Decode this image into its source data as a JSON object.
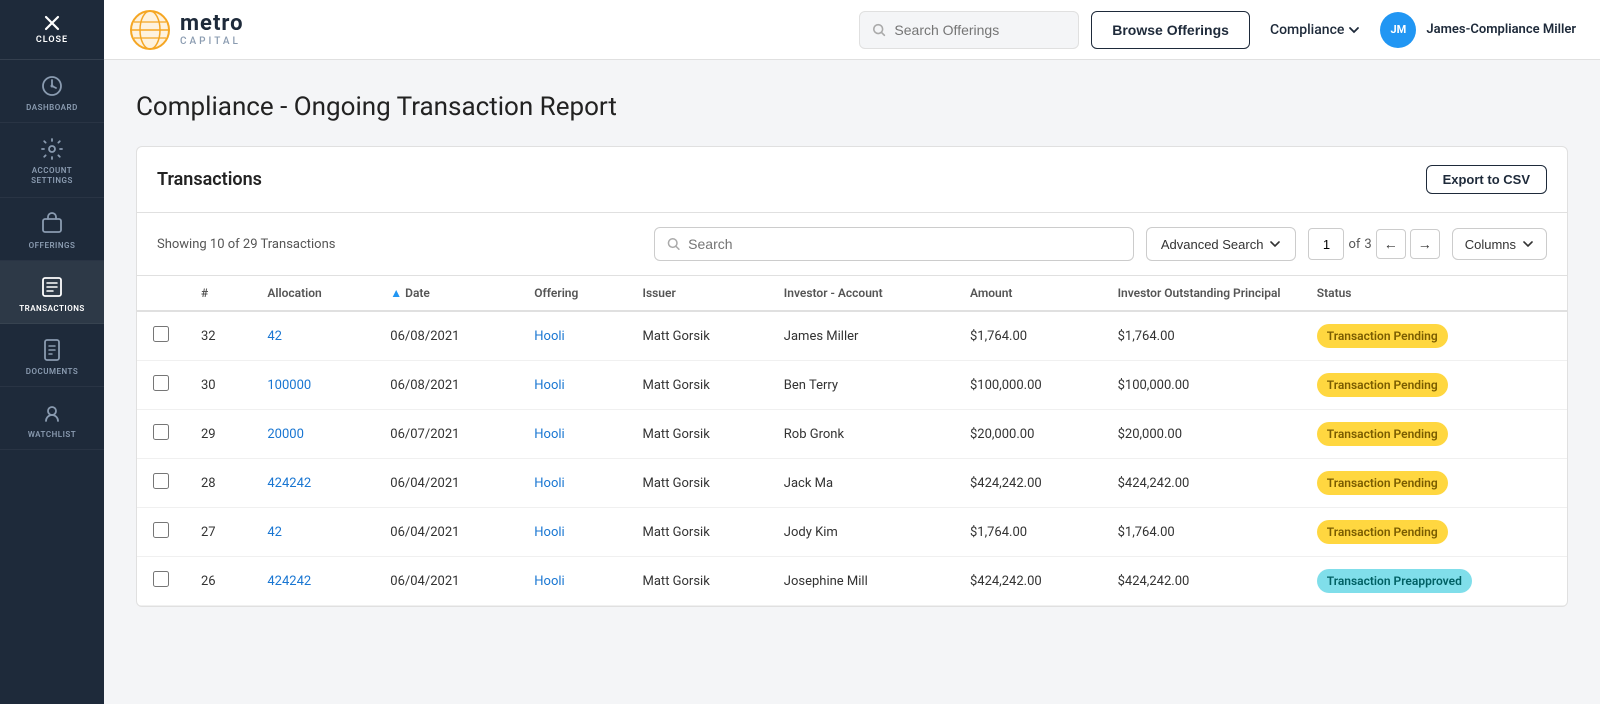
{
  "sidebar": {
    "close_label": "CLOSE",
    "items": [
      {
        "id": "dashboard",
        "label": "DASHBOARD",
        "active": false
      },
      {
        "id": "account-settings",
        "label": "ACCOUNT SETTINGS",
        "active": false
      },
      {
        "id": "offerings",
        "label": "OFFERINGS",
        "active": false
      },
      {
        "id": "transactions",
        "label": "TRANSACTIONS",
        "active": true
      },
      {
        "id": "documents",
        "label": "DOCUMENTS",
        "active": false
      },
      {
        "id": "watchlist",
        "label": "WATCHLIST",
        "active": false
      }
    ]
  },
  "topnav": {
    "logo": {
      "metro": "metro",
      "capital": "CAPITAL"
    },
    "search_placeholder": "Search Offerings",
    "browse_label": "Browse Offerings",
    "compliance_label": "Compliance",
    "user_initials": "JM",
    "user_name": "James-Compliance Miller"
  },
  "page": {
    "title": "Compliance - Ongoing Transaction Report"
  },
  "transactions_card": {
    "title": "Transactions",
    "export_label": "Export to CSV",
    "showing": "Showing 10 of 29 Transactions",
    "search_placeholder": "Search",
    "advanced_search_label": "Advanced Search",
    "page_current": "1",
    "page_total": "3",
    "of_label": "of",
    "columns_label": "Columns",
    "columns": [
      {
        "key": "checkbox",
        "label": ""
      },
      {
        "key": "id",
        "label": "#"
      },
      {
        "key": "allocation",
        "label": "Allocation"
      },
      {
        "key": "date",
        "label": "Date",
        "sorted": true
      },
      {
        "key": "offering",
        "label": "Offering"
      },
      {
        "key": "issuer",
        "label": "Issuer"
      },
      {
        "key": "investor_account",
        "label": "Investor - Account"
      },
      {
        "key": "amount",
        "label": "Amount"
      },
      {
        "key": "outstanding_principal",
        "label": "Investor Outstanding Principal"
      },
      {
        "key": "status",
        "label": "Status"
      }
    ],
    "rows": [
      {
        "id": "32",
        "allocation": "42",
        "date": "06/08/2021",
        "offering": "Hooli",
        "issuer": "Matt Gorsik",
        "investor_account": "James Miller",
        "amount": "$1,764.00",
        "outstanding_principal": "$1,764.00",
        "status": "Transaction Pending",
        "status_type": "pending"
      },
      {
        "id": "30",
        "allocation": "100000",
        "date": "06/08/2021",
        "offering": "Hooli",
        "issuer": "Matt Gorsik",
        "investor_account": "Ben Terry",
        "amount": "$100,000.00",
        "outstanding_principal": "$100,000.00",
        "status": "Transaction Pending",
        "status_type": "pending"
      },
      {
        "id": "29",
        "allocation": "20000",
        "date": "06/07/2021",
        "offering": "Hooli",
        "issuer": "Matt Gorsik",
        "investor_account": "Rob Gronk",
        "amount": "$20,000.00",
        "outstanding_principal": "$20,000.00",
        "status": "Transaction Pending",
        "status_type": "pending"
      },
      {
        "id": "28",
        "allocation": "424242",
        "date": "06/04/2021",
        "offering": "Hooli",
        "issuer": "Matt Gorsik",
        "investor_account": "Jack Ma",
        "amount": "$424,242.00",
        "outstanding_principal": "$424,242.00",
        "status": "Transaction Pending",
        "status_type": "pending"
      },
      {
        "id": "27",
        "allocation": "42",
        "date": "06/04/2021",
        "offering": "Hooli",
        "issuer": "Matt Gorsik",
        "investor_account": "Jody Kim",
        "amount": "$1,764.00",
        "outstanding_principal": "$1,764.00",
        "status": "Transaction Pending",
        "status_type": "pending"
      },
      {
        "id": "26",
        "allocation": "424242",
        "date": "06/04/2021",
        "offering": "Hooli",
        "issuer": "Matt Gorsik",
        "investor_account": "Josephine Mill",
        "amount": "$424,242.00",
        "outstanding_principal": "$424,242.00",
        "status": "Transaction Preapproved",
        "status_type": "preapproved"
      }
    ]
  },
  "colors": {
    "accent_blue": "#2196f3",
    "nav_dark": "#1e2a3a",
    "pending_bg": "#ffd740",
    "preapproved_bg": "#80deea"
  }
}
